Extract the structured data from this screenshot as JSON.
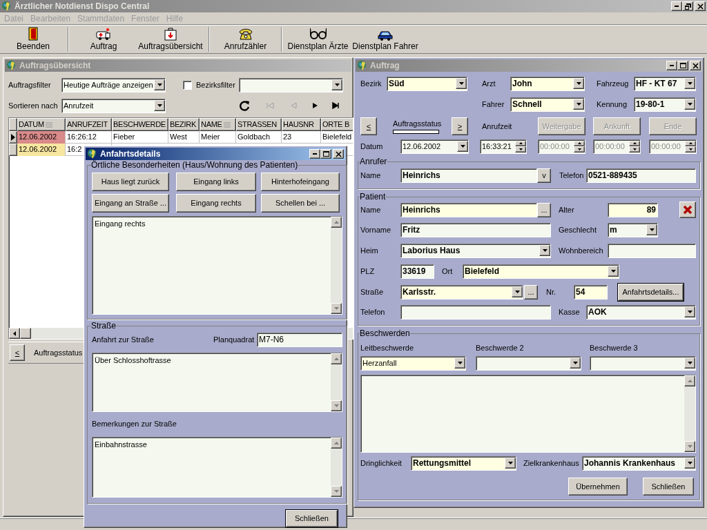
{
  "app": {
    "title": "Ärztlicher Notdienst Dispo Central"
  },
  "menu": [
    {
      "label": "Datei",
      "disabled": true
    },
    {
      "label": "Bearbeiten",
      "disabled": true
    },
    {
      "label": "Stammdaten",
      "disabled": true
    },
    {
      "label": "Fenster",
      "disabled": true
    },
    {
      "label": "Hilfe",
      "disabled": true
    }
  ],
  "toolbar": [
    {
      "label": "Beenden",
      "kind": "door",
      "separator_before": false
    },
    {
      "label": "Auftrag",
      "kind": "ambulance",
      "separator_before": true
    },
    {
      "label": "Auftragsübersicht",
      "kind": "kit",
      "separator_before": false
    },
    {
      "label": "Anrufzähler",
      "kind": "phone",
      "separator_before": true
    },
    {
      "label": "Dienstplan Ärzte",
      "kind": "glasses",
      "separator_before": true
    },
    {
      "label": "Dienstplan Fahrer",
      "kind": "car",
      "separator_before": false
    }
  ],
  "overview": {
    "title": "Auftragsübersicht",
    "active": false,
    "filter": {
      "label": "Auftragsfilter",
      "value": "Heutige Aufträge anzeigen"
    },
    "district_filter": {
      "label": "Bezirksfilter",
      "checked": false
    },
    "sort": {
      "label": "Sortieren nach",
      "value": "Anrufzeit"
    },
    "nav": [
      {
        "kind": "refresh",
        "disabled": false
      },
      {
        "kind": "first",
        "disabled": true
      },
      {
        "kind": "prev",
        "disabled": true
      },
      {
        "kind": "next",
        "disabled": false
      },
      {
        "kind": "last",
        "disabled": false
      }
    ],
    "table": {
      "columns": [
        {
          "label": "DATUM",
          "sorted": true
        },
        {
          "label": "ANRUFZEIT",
          "sorted": false
        },
        {
          "label": "BESCHWERDE",
          "sorted": false
        },
        {
          "label": "BEZIRK",
          "sorted": false
        },
        {
          "label": "NAME",
          "sorted": true
        },
        {
          "label": "STRASSEN",
          "sorted": false
        },
        {
          "label": "HAUSNR",
          "sorted": false
        },
        {
          "label": "ORTE B",
          "sorted": false
        }
      ],
      "rows": [
        {
          "selected": true,
          "color": "#d98a8a",
          "cells": [
            "12.06.2002",
            "16:26:12",
            "Fieber",
            "West",
            "Meier",
            "Goldbach",
            "23",
            "Bielefeld"
          ]
        },
        {
          "selected": false,
          "color": "#f7e6a0",
          "cells": [
            "12.06.2002",
            "16:2"
          ]
        }
      ]
    },
    "status": {
      "prev": "<",
      "label": "Auftragsstatus"
    }
  },
  "order": {
    "title": "Auftrag",
    "active": false,
    "district": {
      "label": "Bezirk",
      "value": "Süd",
      "highlight": true
    },
    "doctor": {
      "label": "Arzt",
      "value": "John",
      "highlight": true
    },
    "vehicle": {
      "label": "Fahrzeug",
      "value": "HF - KT 67",
      "highlight": false
    },
    "driver": {
      "label": "Fahrer",
      "value": "Schnell",
      "highlight": true
    },
    "callsign": {
      "label": "Kennung",
      "value": "19-80-1",
      "highlight": false
    },
    "status": {
      "prev": "<",
      "label": "Auftragsstatus",
      "level": 0,
      "next": ">"
    },
    "call_time_label": "Anrufzeit",
    "actions": [
      {
        "label": "Weitergabe",
        "disabled": true
      },
      {
        "label": "Ankunft",
        "disabled": true
      },
      {
        "label": "Ende",
        "disabled": true
      }
    ],
    "date": {
      "label": "Datum",
      "value": "12.06.2002"
    },
    "times": [
      {
        "value": "16:33:21",
        "disabled": false
      },
      {
        "value": "00:00:00",
        "disabled": true
      },
      {
        "value": "00:00:00",
        "disabled": true
      },
      {
        "value": "00:00:00",
        "disabled": true
      }
    ],
    "caller": {
      "title": "Anrufer",
      "name": {
        "label": "Name",
        "value": "Heinrichs",
        "highlight": false
      },
      "lookup": "v",
      "phone": {
        "label": "Telefon",
        "value": "0521-889435",
        "highlight": false
      }
    },
    "patient": {
      "title": "Patient",
      "name": {
        "label": "Name",
        "value": "Heinrichs",
        "highlight": true
      },
      "name_lookup": "...",
      "age": {
        "label": "Alter",
        "value": "89",
        "highlight": true
      },
      "first_name": {
        "label": "Vorname",
        "value": "Fritz",
        "highlight": false
      },
      "sex": {
        "label": "Geschlecht",
        "value": "m",
        "highlight": false
      },
      "home": {
        "label": "Heim",
        "value": "Laborius Haus",
        "highlight": false
      },
      "ward": {
        "label": "Wohnbereich",
        "highlight": false
      },
      "zip": {
        "label": "PLZ",
        "value": "33619",
        "highlight": false
      },
      "city": {
        "label": "Ort",
        "value": "Bielefeld",
        "highlight": true
      },
      "street": {
        "label": "Straße",
        "value": "Karlsstr.",
        "highlight": true
      },
      "street_lookup": "...",
      "number": {
        "label": "Nr.",
        "value": "54",
        "highlight": true
      },
      "directions_button": "Anfahrtsdetails...",
      "phone": {
        "label": "Telefon",
        "highlight": false
      },
      "insurance": {
        "label": "Kasse",
        "value": "AOK",
        "highlight": false
      }
    },
    "complaints": {
      "title": "Beschwerden",
      "fields": [
        {
          "label": "Leitbeschwerde",
          "value": "Herzanfall",
          "highlight": true
        },
        {
          "label": "Beschwerde 2",
          "highlight": false
        },
        {
          "label": "Beschwerde 3",
          "highlight": false
        }
      ],
      "urgency": {
        "label": "Dringlichkeit",
        "value": "Rettungsmittel",
        "highlight": true
      },
      "hospital": {
        "label": "Zielkrankenhaus",
        "value": "Johannis Krankenhaus",
        "highlight": false
      }
    },
    "buttons": [
      "Übernehmen",
      "Schließen"
    ]
  },
  "directions": {
    "title": "Anfahrtsdetails",
    "active": true,
    "house_group": "Örtliche Besonderheiten (Haus/Wohnung des Patienten)",
    "quick_buttons": [
      "Haus liegt zurück",
      "Eingang links",
      "Hinterhofeingang",
      "Eingang an Straße ...",
      "Eingang rechts",
      "Schellen bei ..."
    ],
    "house_notes": "Eingang rechts",
    "street_group": "Straße",
    "approach_label": "Anfahrt zur Straße",
    "grid": {
      "label": "Planquadrat",
      "value": "M7-N6"
    },
    "approach_text": "Über Schlosshoftrasse",
    "remarks_label": "Bemerkungen zur Straße",
    "remarks_text": "Einbahnstrasse",
    "close": "Schließen"
  }
}
